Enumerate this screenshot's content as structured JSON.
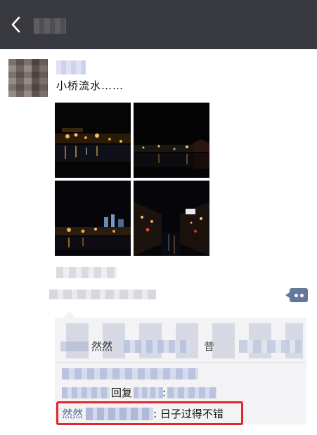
{
  "header": {
    "back_icon": "chevron-left-icon",
    "background": "#393a3f"
  },
  "post": {
    "text": "小桥流水……",
    "photos": [
      {
        "scene": "night-river-lanterns"
      },
      {
        "scene": "night-river-distant-lights"
      },
      {
        "scene": "night-river-city-glow"
      },
      {
        "scene": "night-canal-street"
      }
    ]
  },
  "actions": {
    "more_icon": "more-dots-icon",
    "accent": "#64789a"
  },
  "comments": {
    "like_name": "然然",
    "like_char": "昔",
    "reply_label": "回复",
    "reply_colon": ":",
    "highlighted": {
      "name": "然然",
      "text": ": 日子过得不错",
      "border_color": "#e5262b",
      "name_color": "#566b94"
    }
  }
}
